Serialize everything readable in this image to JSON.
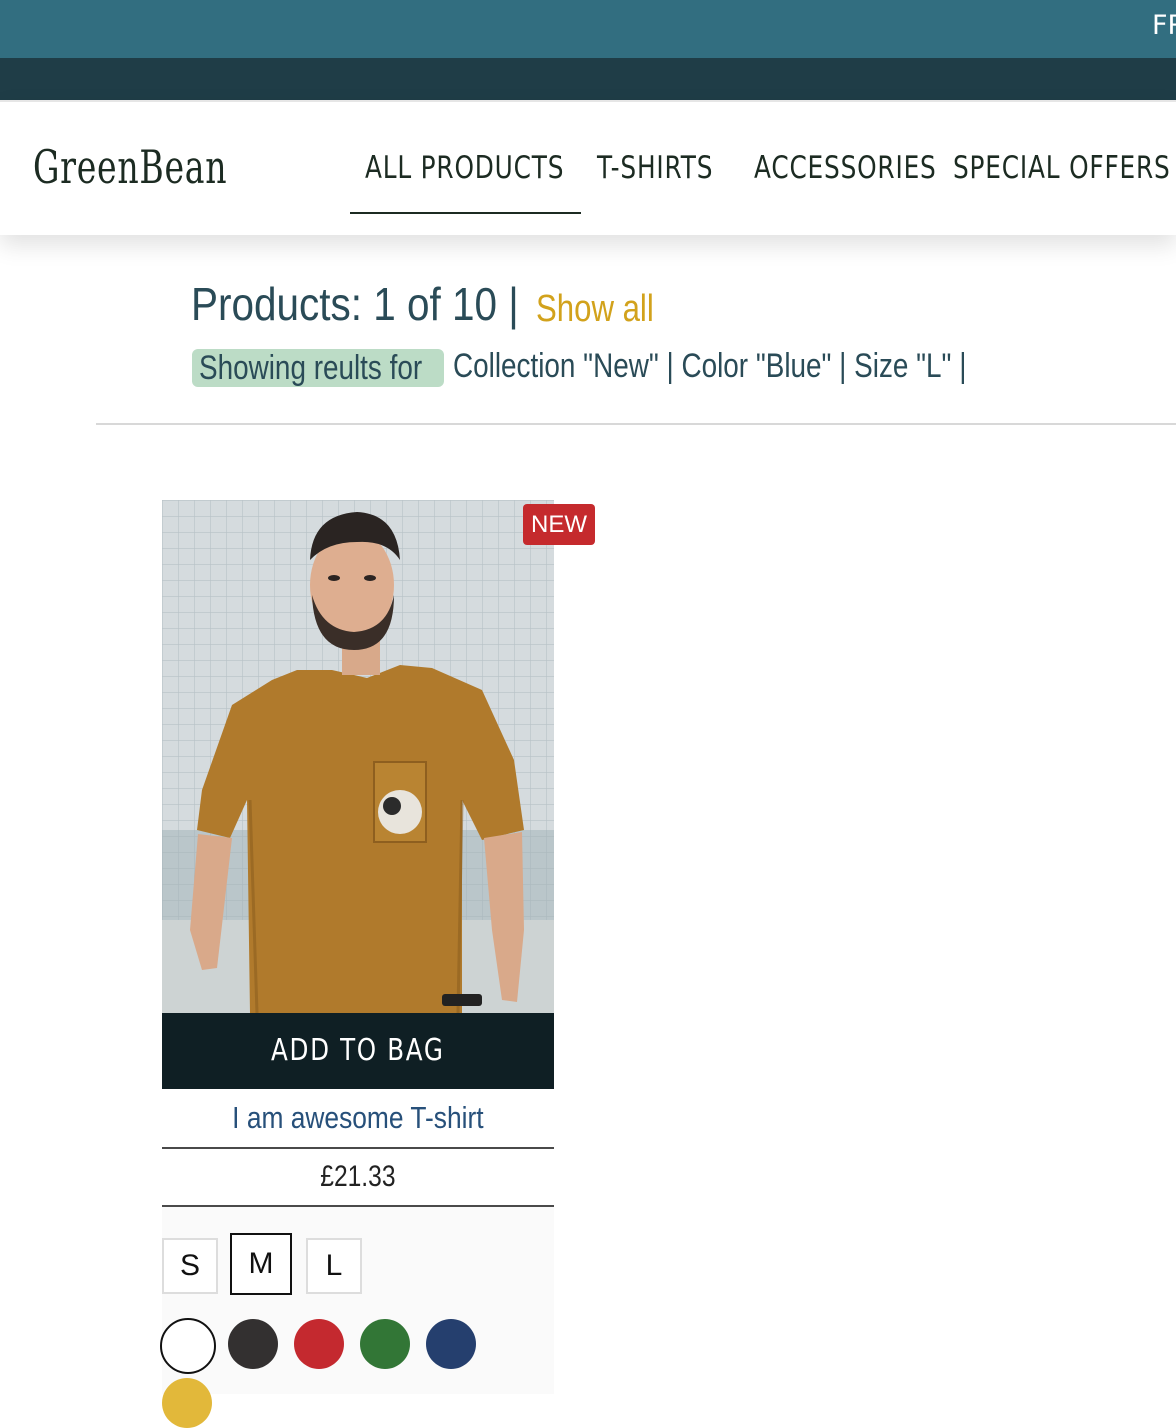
{
  "topbar": {
    "text": "FR"
  },
  "header": {
    "logo": "GreenBean",
    "nav": [
      "ALL PRODUCTS",
      "T-SHIRTS",
      "ACCESSORIES",
      "SPECIAL OFFERS"
    ]
  },
  "results": {
    "count_text": "Products: 1 of 10 |",
    "show_all": "Show all",
    "filter_label": "Showing reults for",
    "filter_values": "Collection \"New\" | Color \"Blue\" | Size \"L\" |"
  },
  "product": {
    "badge": "NEW",
    "add_to_bag": "ADD TO BAG",
    "name": "I am awesome T-shirt",
    "price": "£21.33",
    "sizes": [
      "S",
      "M",
      "L"
    ],
    "selected_size": "M",
    "colors": [
      "#ffffff",
      "#333030",
      "#c4292f",
      "#327636",
      "#253f6e",
      "#e2b83a"
    ],
    "selected_color": "#ffffff"
  }
}
